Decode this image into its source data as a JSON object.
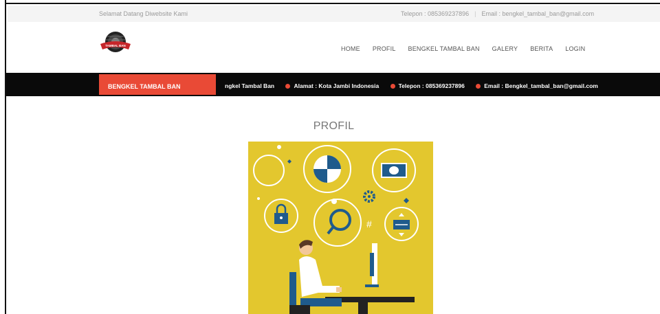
{
  "topbar": {
    "welcome": "Selamat Datang Diwebsite Kami",
    "phone": "Telepon : 085369237896",
    "email": "Email : bengkel_tambal_ban@gmail.com"
  },
  "logo": {
    "text": "TAMBAL BAN"
  },
  "nav": {
    "items": [
      "HOME",
      "PROFIL",
      "BENGKEL TAMBAL BAN",
      "GALERY",
      "BERITA",
      "LOGIN"
    ]
  },
  "ticker": {
    "label": "BENGKEL TAMBAL BAN",
    "lead": "ngkel Tambal Ban",
    "items": [
      "Alamat : Kota Jambi Indonesia",
      "Telepon : 085369237896",
      "Email : Bengkel_tambal_ban@gmail.com"
    ]
  },
  "main": {
    "title": "PROFIL"
  },
  "colors": {
    "accent": "#e94a36",
    "illustration_bg": "#e3c72e",
    "ticker_bg": "#0a0a0a"
  }
}
